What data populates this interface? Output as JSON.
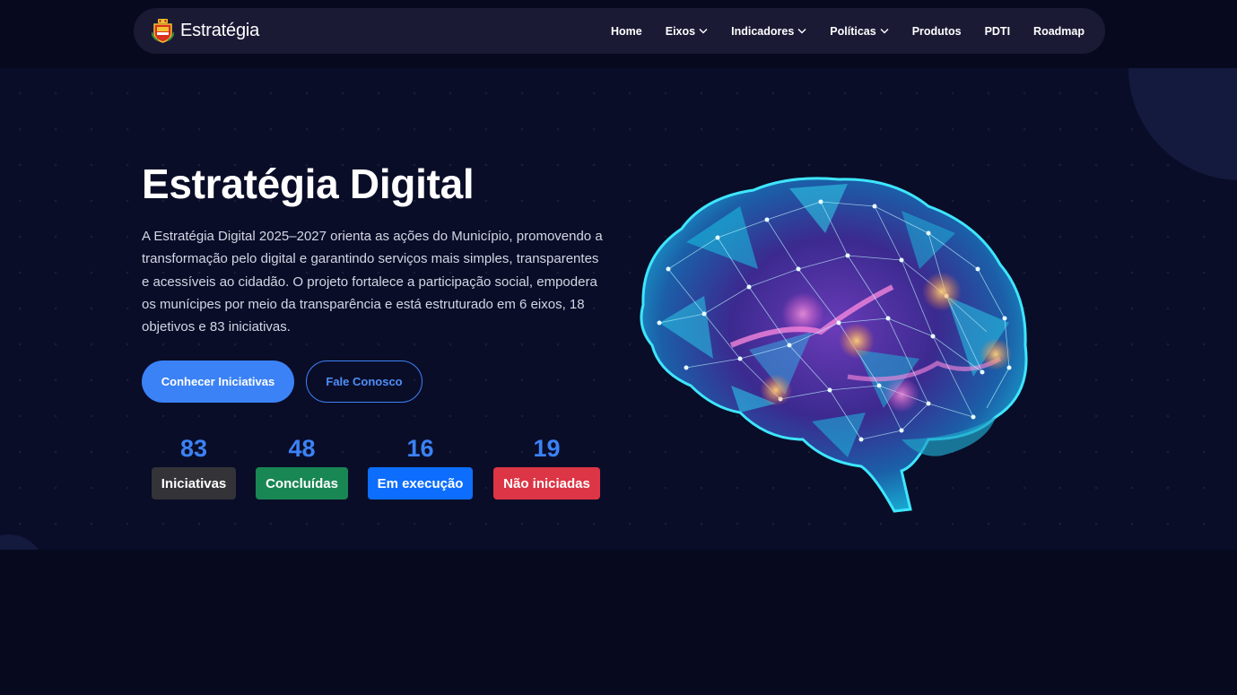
{
  "brand": {
    "name": "Estratégia",
    "logo_icon": "coat-of-arms-icon"
  },
  "nav": {
    "items": [
      {
        "label": "Home",
        "dropdown": false
      },
      {
        "label": "Eixos",
        "dropdown": true
      },
      {
        "label": "Indicadores",
        "dropdown": true
      },
      {
        "label": "Políticas",
        "dropdown": true
      },
      {
        "label": "Produtos",
        "dropdown": false
      },
      {
        "label": "PDTI",
        "dropdown": false
      },
      {
        "label": "Roadmap",
        "dropdown": false
      }
    ]
  },
  "hero": {
    "title": "Estratégia Digital",
    "description": "A Estratégia Digital 2025–2027 orienta as ações do Município, promovendo a transformação pelo digital e garantindo serviços mais simples, transparentes e acessíveis ao cidadão. O projeto fortalece a participação social, empodera os munícipes por meio da transparência e está estruturado em 6 eixos, 18 objetivos e 83 iniciativas.",
    "primary_button": "Conhecer Iniciativas",
    "secondary_button": "Fale Conosco",
    "image_icon": "brain-network-illustration"
  },
  "stats": [
    {
      "value": "83",
      "label": "Iniciativas",
      "color": "#333338"
    },
    {
      "value": "48",
      "label": "Concluídas",
      "color": "#198754"
    },
    {
      "value": "16",
      "label": "Em execução",
      "color": "#0d6efd"
    },
    {
      "value": "19",
      "label": "Não iniciadas",
      "color": "#dc3545"
    }
  ],
  "colors": {
    "accent": "#3b82f6",
    "background": "#070a1e",
    "hero_background": "#0a0d28",
    "navbar": "#1a1a35"
  }
}
